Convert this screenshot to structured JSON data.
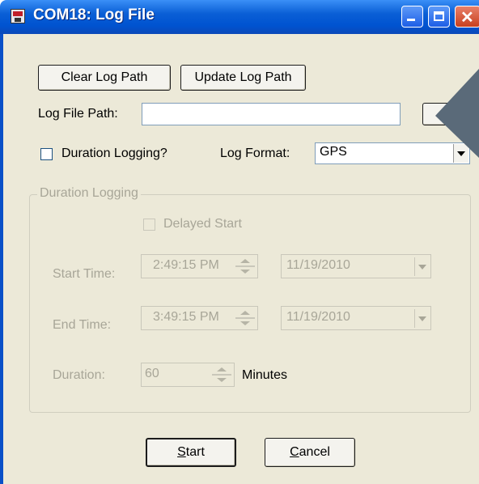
{
  "window": {
    "title": "COM18: Log File"
  },
  "toolbar": {
    "clear_log_path": "Clear Log Path",
    "update_log_path": "Update Log Path"
  },
  "log_file_path": {
    "label": "Log File Path:",
    "value": "",
    "browse_label": "..."
  },
  "duration_logging_checkbox": {
    "label": "Duration Logging?",
    "checked": false
  },
  "log_format": {
    "label": "Log Format:",
    "value": "GPS"
  },
  "duration_group": {
    "legend": "Duration Logging",
    "delayed_start": {
      "label": "Delayed Start",
      "checked": false
    },
    "start_time": {
      "label": "Start Time:",
      "time": "2:49:15 PM",
      "date": "11/19/2010"
    },
    "end_time": {
      "label": "End Time:",
      "time": "3:49:15 PM",
      "date": "11/19/2010"
    },
    "duration": {
      "label": "Duration:",
      "value": "60",
      "unit": "Minutes"
    }
  },
  "actions": {
    "start_prefix": "S",
    "start_rest": "tart",
    "cancel_prefix": "C",
    "cancel_rest": "ancel"
  },
  "colors": {
    "title_bar": "#0a5fd6",
    "dialog_bg": "#ece9d8",
    "disabled_text": "#a8a698",
    "overlay_arrow": "#5a6a79"
  }
}
